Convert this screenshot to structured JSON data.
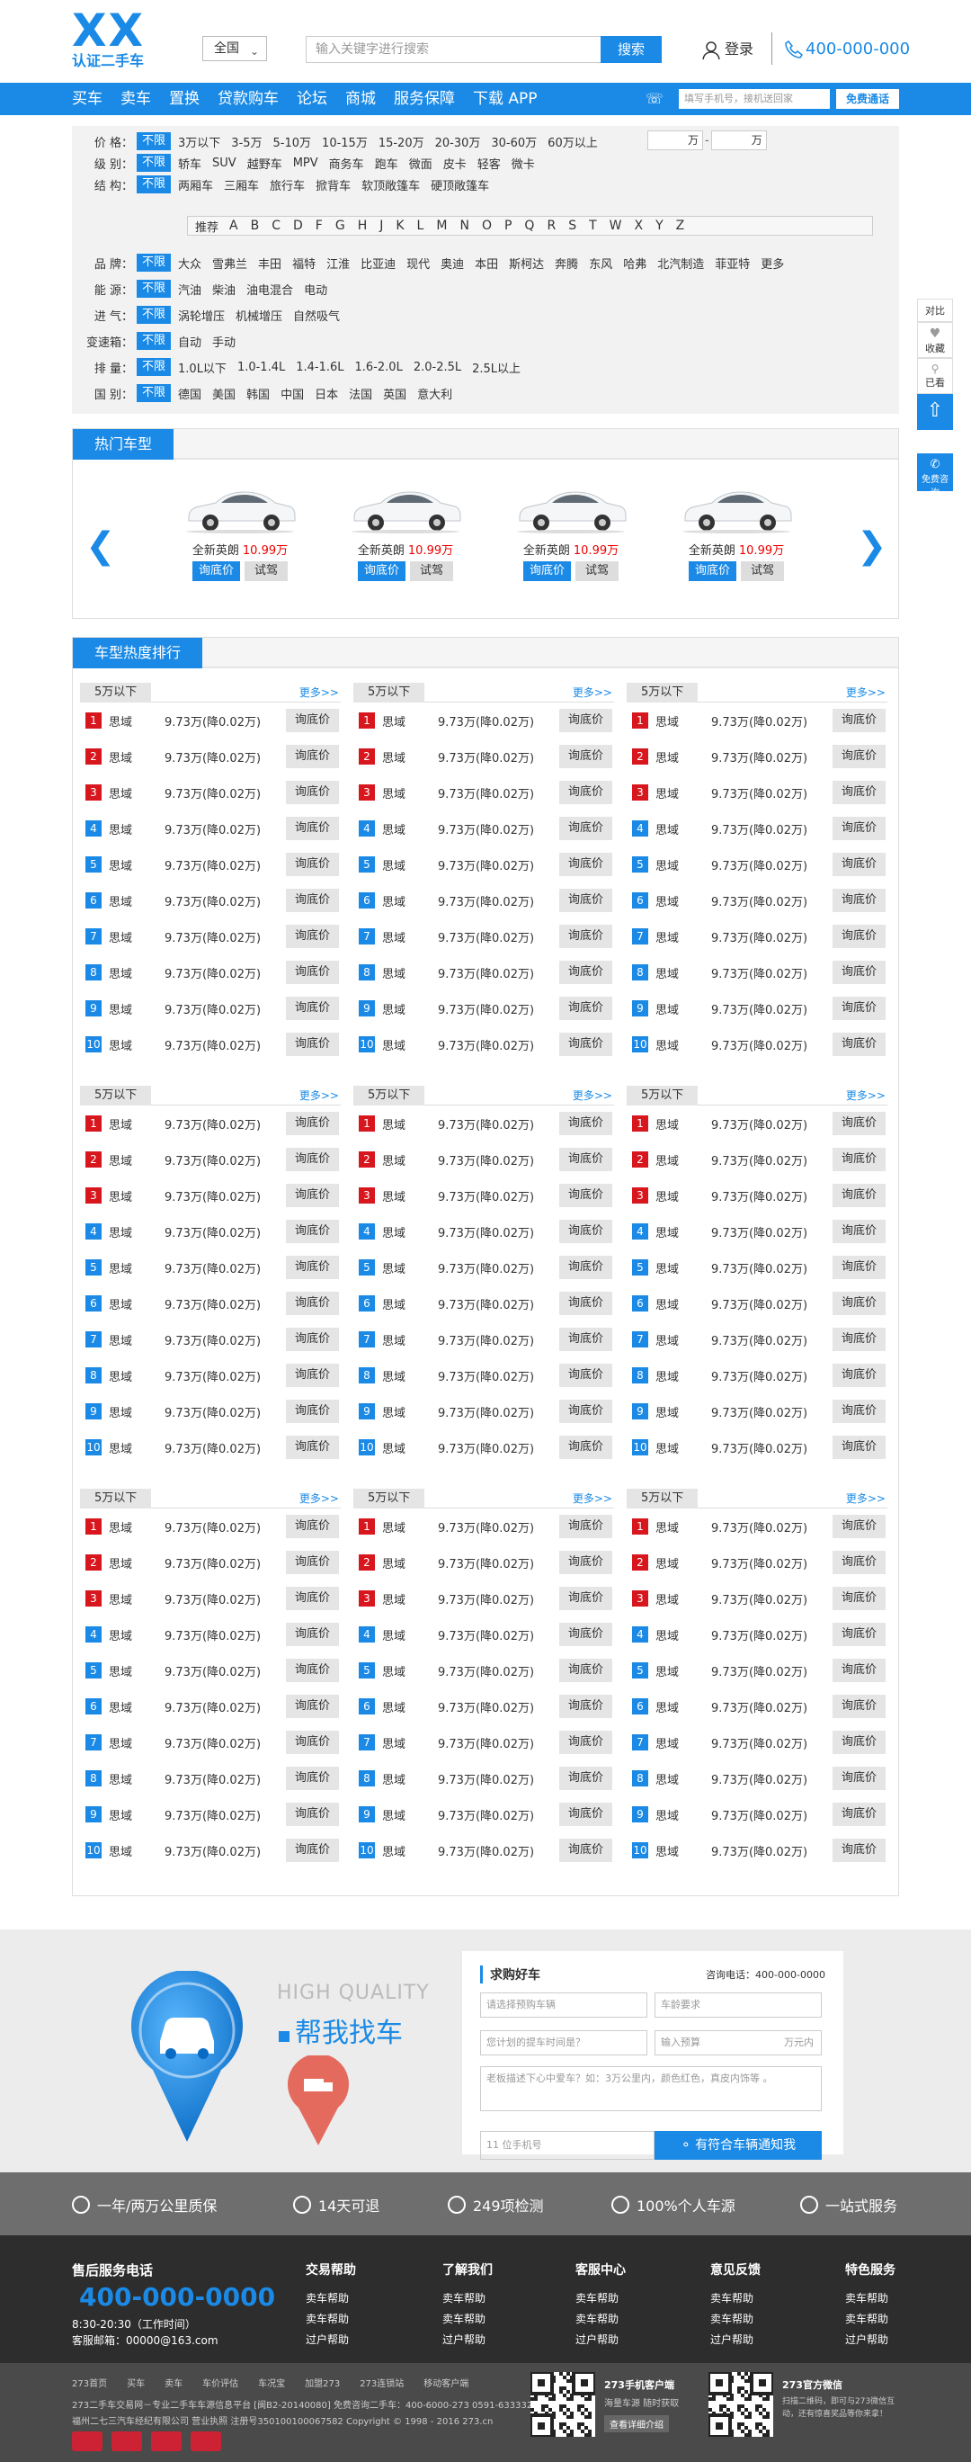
{
  "header": {
    "logo_main": "XX",
    "logo_sub": "认证二手车",
    "city": "全国",
    "search_placeholder": "输入关键字进行搜索",
    "search_button": "搜索",
    "login": "登录",
    "phone": "400-000-000"
  },
  "nav": {
    "items": [
      "买车",
      "卖车",
      "置换",
      "贷款购车",
      "论坛",
      "商城",
      "服务保障",
      "下载 APP"
    ],
    "phone_placeholder": "填写手机号，接机送回家",
    "free_button": "免费通话"
  },
  "filter": {
    "unlimited": "不限",
    "rows": [
      {
        "label": "价 格：",
        "options": [
          "3万以下",
          "3-5万",
          "5-10万",
          "10-15万",
          "15-20万",
          "20-30万",
          "30-60万",
          "60万以上"
        ]
      },
      {
        "label": "级 别：",
        "options": [
          "轿车",
          "SUV",
          "越野车",
          "MPV",
          "商务车",
          "跑车",
          "微面",
          "皮卡",
          "轻客",
          "微卡"
        ]
      },
      {
        "label": "结 构：",
        "options": [
          "两厢车",
          "三厢车",
          "旅行车",
          "掀背车",
          "软顶敞篷车",
          "硬顶敞篷车"
        ]
      },
      {
        "label": "品 牌：",
        "options": [
          "大众",
          "雪弗兰",
          "丰田",
          "福特",
          "江淮",
          "比亚迪",
          "现代",
          "奥迪",
          "本田",
          "斯柯达",
          "奔腾",
          "东风",
          "哈弗",
          "北汽制造",
          "菲亚特",
          "更多"
        ]
      },
      {
        "label": "能 源：",
        "options": [
          "汽油",
          "柴油",
          "油电混合",
          "电动"
        ]
      },
      {
        "label": "进 气：",
        "options": [
          "涡轮增压",
          "机械增压",
          "自然吸气"
        ]
      },
      {
        "label": "变速箱：",
        "options": [
          "自动",
          "手动"
        ]
      },
      {
        "label": "排 量：",
        "options": [
          "1.0L以下",
          "1.0-1.4L",
          "1.4-1.6L",
          "1.6-2.0L",
          "2.0-2.5L",
          "2.5L以上"
        ]
      },
      {
        "label": "国 别：",
        "options": [
          "德国",
          "美国",
          "韩国",
          "中国",
          "日本",
          "法国",
          "英国",
          "意大利"
        ]
      }
    ],
    "price_unit": "万",
    "recommend": "推荐",
    "letters": [
      "A",
      "B",
      "C",
      "D",
      "F",
      "G",
      "H",
      "J",
      "K",
      "L",
      "M",
      "N",
      "O",
      "P",
      "Q",
      "R",
      "S",
      "T",
      "W",
      "X",
      "Y",
      "Z"
    ]
  },
  "hot": {
    "title": "热门车型",
    "cars": [
      {
        "name": "全新英朗",
        "price": "10.99万",
        "ask": "询底价",
        "test": "试驾"
      },
      {
        "name": "全新英朗",
        "price": "10.99万",
        "ask": "询底价",
        "test": "试驾"
      },
      {
        "name": "全新英朗",
        "price": "10.99万",
        "ask": "询底价",
        "test": "试驾"
      },
      {
        "name": "全新英朗",
        "price": "10.99万",
        "ask": "询底价",
        "test": "试驾"
      }
    ]
  },
  "rank": {
    "title": "车型热度排行",
    "group_title": "5万以下",
    "more": "更多>>",
    "item_name": "思域",
    "item_price": "9.73万(降0.02万)",
    "item_ask": "询底价",
    "numbers": [
      "1",
      "2",
      "3",
      "4",
      "5",
      "6",
      "7",
      "8",
      "9",
      "10"
    ]
  },
  "find": {
    "hq": "HIGH QUALITY",
    "title": "帮我找车",
    "form_title": "求购好车",
    "form_tel": "咨询电话：400-000-0000",
    "f1": "请选择预购车辆",
    "f2": "车龄要求",
    "f3": "您计划的提车时间是？",
    "f4": "输入预算",
    "f4_unit": "万元内",
    "f5": "老板描述下心中爱车？如：3万公里内，颜色红色，真皮内饰等 。",
    "f6": "11 位手机号",
    "submit": "有符合车辆通知我"
  },
  "guarantees": [
    "一年/两万公里质保",
    "14天可退",
    "249项检测",
    "100%个人车源",
    "一站式服务"
  ],
  "footer": {
    "service": "售后服务电话",
    "phone": "400-000-0000",
    "time": "8:30-20:30（工作时间）",
    "email": "客服邮箱：00000@163.com",
    "cols": [
      {
        "h": "交易帮助",
        "items": [
          "卖车帮助",
          "卖车帮助",
          "过户帮助"
        ]
      },
      {
        "h": "了解我们",
        "items": [
          "卖车帮助",
          "卖车帮助",
          "过户帮助"
        ]
      },
      {
        "h": "客服中心",
        "items": [
          "卖车帮助",
          "卖车帮助",
          "过户帮助"
        ]
      },
      {
        "h": "意见反馈",
        "items": [
          "卖车帮助",
          "卖车帮助",
          "过户帮助"
        ]
      },
      {
        "h": "特色服务",
        "items": [
          "卖车帮助",
          "卖车帮助",
          "过户帮助"
        ]
      }
    ]
  },
  "copyright": {
    "links": [
      "273首页",
      "买车",
      "卖车",
      "车价评估",
      "车况宝",
      "加盟273",
      "273连锁站",
      "移动客户端"
    ],
    "l1": "273二手车交易网－专业二手车车源信息平台 [闽B2-20140080]  免费咨询二手车：400-6000-273 0591-63333273",
    "l2": "福州二七三汽车经纪有限公司 营业执照 注册号350100100067582  Copyright © 1998 - 2016 273.cn",
    "app_title": "273手机客户端",
    "app_desc": "海量车源 随时获取",
    "app_btn": "查看详细介绍",
    "wx_title": "273官方微信",
    "wx_desc": "扫描二维码，即可与273微信互动，还有惊喜奖品等你来拿！"
  },
  "side": {
    "compare": "对比",
    "fav": "收藏",
    "seen": "已看",
    "consult": "免费咨询"
  }
}
